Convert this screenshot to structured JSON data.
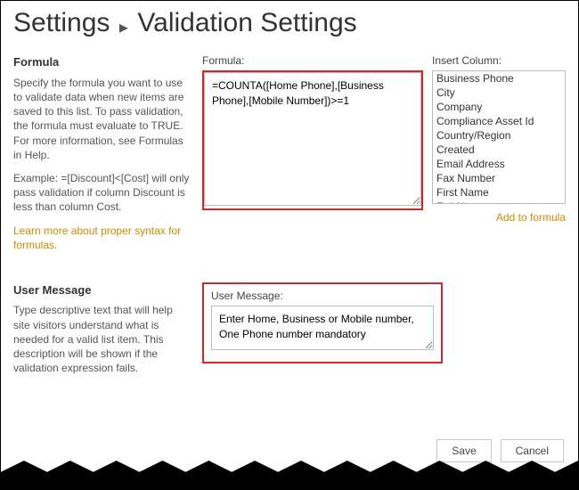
{
  "header": {
    "crumb1": "Settings",
    "crumb2": "Validation Settings"
  },
  "formula_section": {
    "title": "Formula",
    "desc1": "Specify the formula you want to use to validate data when new items are saved to this list. To pass validation, the formula must evaluate to TRUE. For more information, see Formulas in Help.",
    "desc2": "Example: =[Discount]<[Cost] will only pass validation if column Discount is less than column Cost.",
    "link": "Learn more about proper syntax for formulas.",
    "field_label": "Formula:",
    "field_value": "=COUNTA([Home Phone],[Business Phone],[Mobile Number])>=1",
    "insert_label": "Insert Column:",
    "columns": [
      "Business Phone",
      "City",
      "Company",
      "Compliance Asset Id",
      "Country/Region",
      "Created",
      "Email Address",
      "Fax Number",
      "First Name",
      "Full Name"
    ],
    "add_link": "Add to formula"
  },
  "message_section": {
    "title": "User Message",
    "desc": "Type descriptive text that will help site visitors understand what is needed for a valid list item. This description will be shown if the validation expression fails.",
    "field_label": "User Message:",
    "field_value": "Enter Home, Business or Mobile number, One Phone number mandatory"
  },
  "buttons": {
    "save": "Save",
    "cancel": "Cancel"
  }
}
